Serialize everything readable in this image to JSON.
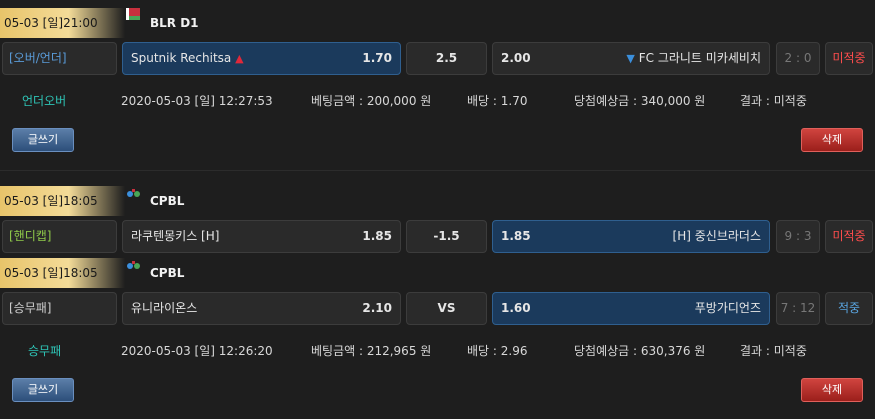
{
  "bet1": {
    "date": "05-03 [일]21:00",
    "league": "BLR D1",
    "type": "[오버/언더]",
    "home": "Sputnik Rechitsa",
    "home_odd": "1.70",
    "line": "2.5",
    "away_odd": "2.00",
    "away": "FC 그라니트 미카세비치",
    "score": "2 : 0",
    "status": "미적중",
    "detail_type": "언더오버",
    "detail_time": "2020-05-03 [일] 12:27:53",
    "detail_amount": "베팅금액 : 200,000 원",
    "detail_odds": "배당 : 1.70",
    "detail_expected": "당첨예상금 : 340,000 원",
    "detail_result": "결과 : 미적중",
    "btn_write": "글쓰기",
    "btn_delete": "삭제"
  },
  "bet2": {
    "game1": {
      "date": "05-03 [일]18:05",
      "league": "CPBL",
      "type": "[핸디캡]",
      "home": "라쿠텐몽키스 [H]",
      "home_odd": "1.85",
      "line": "-1.5",
      "away_odd": "1.85",
      "away": "[H] 중신브라더스",
      "score": "9 : 3",
      "status": "미적중"
    },
    "game2": {
      "date": "05-03 [일]18:05",
      "league": "CPBL",
      "type": "[승무패]",
      "home": "유니라이온스",
      "home_odd": "2.10",
      "line": "VS",
      "away_odd": "1.60",
      "away": "푸방가디언즈",
      "score": "7 : 12",
      "status": "적중"
    },
    "detail_type": "승무패",
    "detail_time": "2020-05-03 [일] 12:26:20",
    "detail_amount": "베팅금액 : 212,965 원",
    "detail_odds": "배당 : 2.96",
    "detail_expected": "당첨예상금 : 630,376 원",
    "detail_result": "결과 : 미적중",
    "btn_write": "글쓰기",
    "btn_delete": "삭제"
  },
  "colors": {
    "gold": "#e8c46a",
    "accent_blue": "#5a9bd8",
    "teal": "#2ec4b6",
    "red": "#ff4d4d",
    "selected_bg": "#1b3a5c"
  }
}
